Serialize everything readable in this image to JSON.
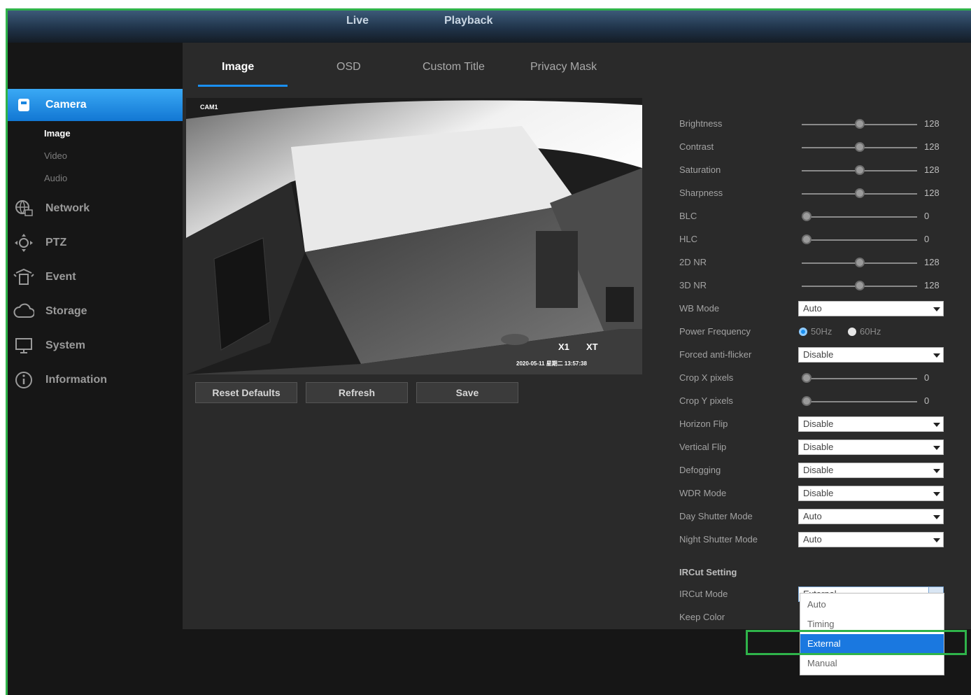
{
  "topnav": {
    "live": "Live",
    "playback": "Playback"
  },
  "sidebar": {
    "items": [
      {
        "label": "Camera",
        "icon": "camera-icon"
      },
      {
        "label": "Network",
        "icon": "network-icon"
      },
      {
        "label": "PTZ",
        "icon": "ptz-icon"
      },
      {
        "label": "Event",
        "icon": "event-icon"
      },
      {
        "label": "Storage",
        "icon": "storage-icon"
      },
      {
        "label": "System",
        "icon": "system-icon"
      },
      {
        "label": "Information",
        "icon": "information-icon"
      }
    ],
    "camera_sub": [
      "Image",
      "Video",
      "Audio"
    ]
  },
  "tabs": [
    "Image",
    "OSD",
    "Custom Title",
    "Privacy Mask"
  ],
  "preview": {
    "osd_name": "CAM1",
    "osd_zoom1": "X1",
    "osd_zoom2": "XT",
    "osd_time": "2020-05-11  星期二  13:57:38"
  },
  "buttons": {
    "reset": "Reset Defaults",
    "refresh": "Refresh",
    "save": "Save"
  },
  "params": {
    "brightness": {
      "label": "Brightness",
      "value": "128",
      "level": 0.5
    },
    "contrast": {
      "label": "Contrast",
      "value": "128",
      "level": 0.5
    },
    "saturation": {
      "label": "Saturation",
      "value": "128",
      "level": 0.5
    },
    "sharpness": {
      "label": "Sharpness",
      "value": "128",
      "level": 0.5
    },
    "blc": {
      "label": "BLC",
      "value": "0",
      "level": 0
    },
    "hlc": {
      "label": "HLC",
      "value": "0",
      "level": 0
    },
    "nr2d": {
      "label": "2D NR",
      "value": "128",
      "level": 0.5
    },
    "nr3d": {
      "label": "3D NR",
      "value": "128",
      "level": 0.5
    },
    "wb_mode": {
      "label": "WB Mode",
      "value": "Auto"
    },
    "power_frequency": {
      "label": "Power Frequency",
      "opt1": "50Hz",
      "opt2": "60Hz"
    },
    "forced_anti_flicker": {
      "label": "Forced anti-flicker",
      "value": "Disable"
    },
    "crop_x": {
      "label": "Crop X pixels",
      "value": "0",
      "level": 0
    },
    "crop_y": {
      "label": "Crop Y pixels",
      "value": "0",
      "level": 0
    },
    "horizon_flip": {
      "label": "Horizon Flip",
      "value": "Disable"
    },
    "vertical_flip": {
      "label": "Vertical Flip",
      "value": "Disable"
    },
    "defogging": {
      "label": "Defogging",
      "value": "Disable"
    },
    "wdr_mode": {
      "label": "WDR Mode",
      "value": "Disable"
    },
    "day_shutter_mode": {
      "label": "Day Shutter Mode",
      "value": "Auto"
    },
    "night_shutter_mode": {
      "label": "Night Shutter Mode",
      "value": "Auto"
    }
  },
  "ircut": {
    "section_title": "IRCut Setting",
    "mode_label": "IRCut Mode",
    "mode_value": "External",
    "keep_color_label": "Keep Color",
    "options": [
      "Auto",
      "Timing",
      "External",
      "Manual"
    ],
    "selected_option": "External"
  },
  "colors": {
    "accent": "#1a8ff0",
    "highlight": "#2fb34a",
    "panel": "#2a2a2a",
    "background": "#161616"
  }
}
